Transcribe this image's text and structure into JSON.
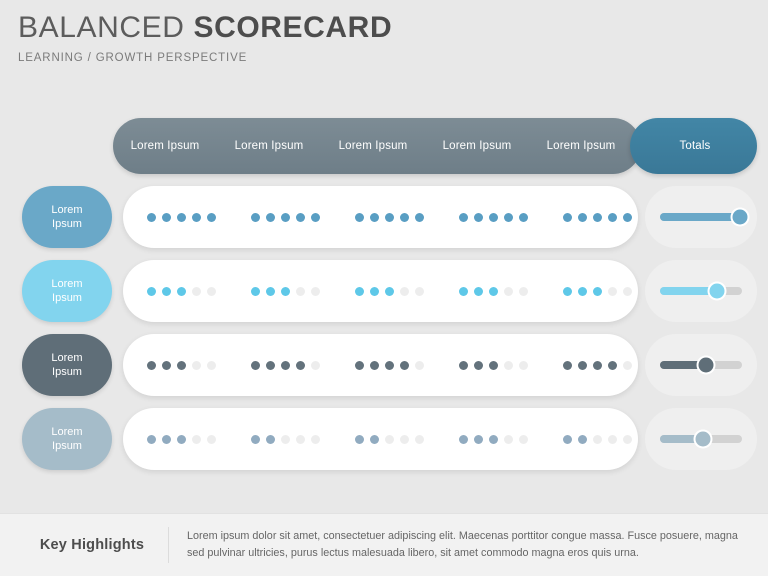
{
  "header": {
    "title_light": "BALANCED",
    "title_bold": "SCORECARD",
    "subtitle": "LEARNING / GROWTH PERSPECTIVE"
  },
  "table": {
    "columns": [
      {
        "label": "Lorem Ipsum"
      },
      {
        "label": "Lorem Ipsum"
      },
      {
        "label": "Lorem Ipsum"
      },
      {
        "label": "Lorem Ipsum"
      },
      {
        "label": "Lorem Ipsum"
      }
    ],
    "totals_column": {
      "label": "Totals"
    },
    "dots_per_group": 5,
    "rows": [
      {
        "label_line1": "Lorem",
        "label_line2": "Ipsum",
        "color": "#6aa8c8",
        "dot_color": "#599ec3",
        "scores": [
          5,
          5,
          5,
          5,
          5
        ],
        "total_percent": 97
      },
      {
        "label_line1": "Lorem",
        "label_line2": "Ipsum",
        "color": "#82d4ee",
        "dot_color": "#5ec8e8",
        "scores": [
          3,
          3,
          3,
          3,
          3
        ],
        "total_percent": 69
      },
      {
        "label_line1": "Lorem",
        "label_line2": "Ipsum",
        "color": "#5f6e78",
        "dot_color": "#63727c",
        "scores": [
          3,
          4,
          4,
          3,
          4
        ],
        "total_percent": 56
      },
      {
        "label_line1": "Lorem",
        "label_line2": "Ipsum",
        "color": "#a5bcc9",
        "dot_color": "#91abc0",
        "scores": [
          3,
          2,
          2,
          3,
          2
        ],
        "total_percent": 52
      }
    ]
  },
  "footer": {
    "label": "Key Highlights",
    "text": "Lorem ipsum dolor sit amet, consectetuer adipiscing elit. Maecenas porttitor congue massa. Fusce posuere, magna sed pulvinar ultricies, purus lectus malesuada libero, sit amet commodo magna eros quis urna."
  },
  "chart_data": {
    "type": "table",
    "title": "BALANCED SCORECARD",
    "subtitle": "LEARNING / GROWTH PERSPECTIVE",
    "categories": [
      "Lorem Ipsum",
      "Lorem Ipsum",
      "Lorem Ipsum",
      "Lorem Ipsum",
      "Lorem Ipsum"
    ],
    "scale_max": 5,
    "series": [
      {
        "name": "Lorem Ipsum",
        "values": [
          5,
          5,
          5,
          5,
          5
        ],
        "total_percent": 97,
        "color": "#6aa8c8"
      },
      {
        "name": "Lorem Ipsum",
        "values": [
          3,
          3,
          3,
          3,
          3
        ],
        "total_percent": 69,
        "color": "#82d4ee"
      },
      {
        "name": "Lorem Ipsum",
        "values": [
          3,
          4,
          4,
          3,
          4
        ],
        "total_percent": 56,
        "color": "#5f6e78"
      },
      {
        "name": "Lorem Ipsum",
        "values": [
          3,
          2,
          2,
          3,
          2
        ],
        "total_percent": 52,
        "color": "#a5bcc9"
      }
    ],
    "totals_label": "Totals",
    "legend": "position: left-badges",
    "grid": false
  }
}
